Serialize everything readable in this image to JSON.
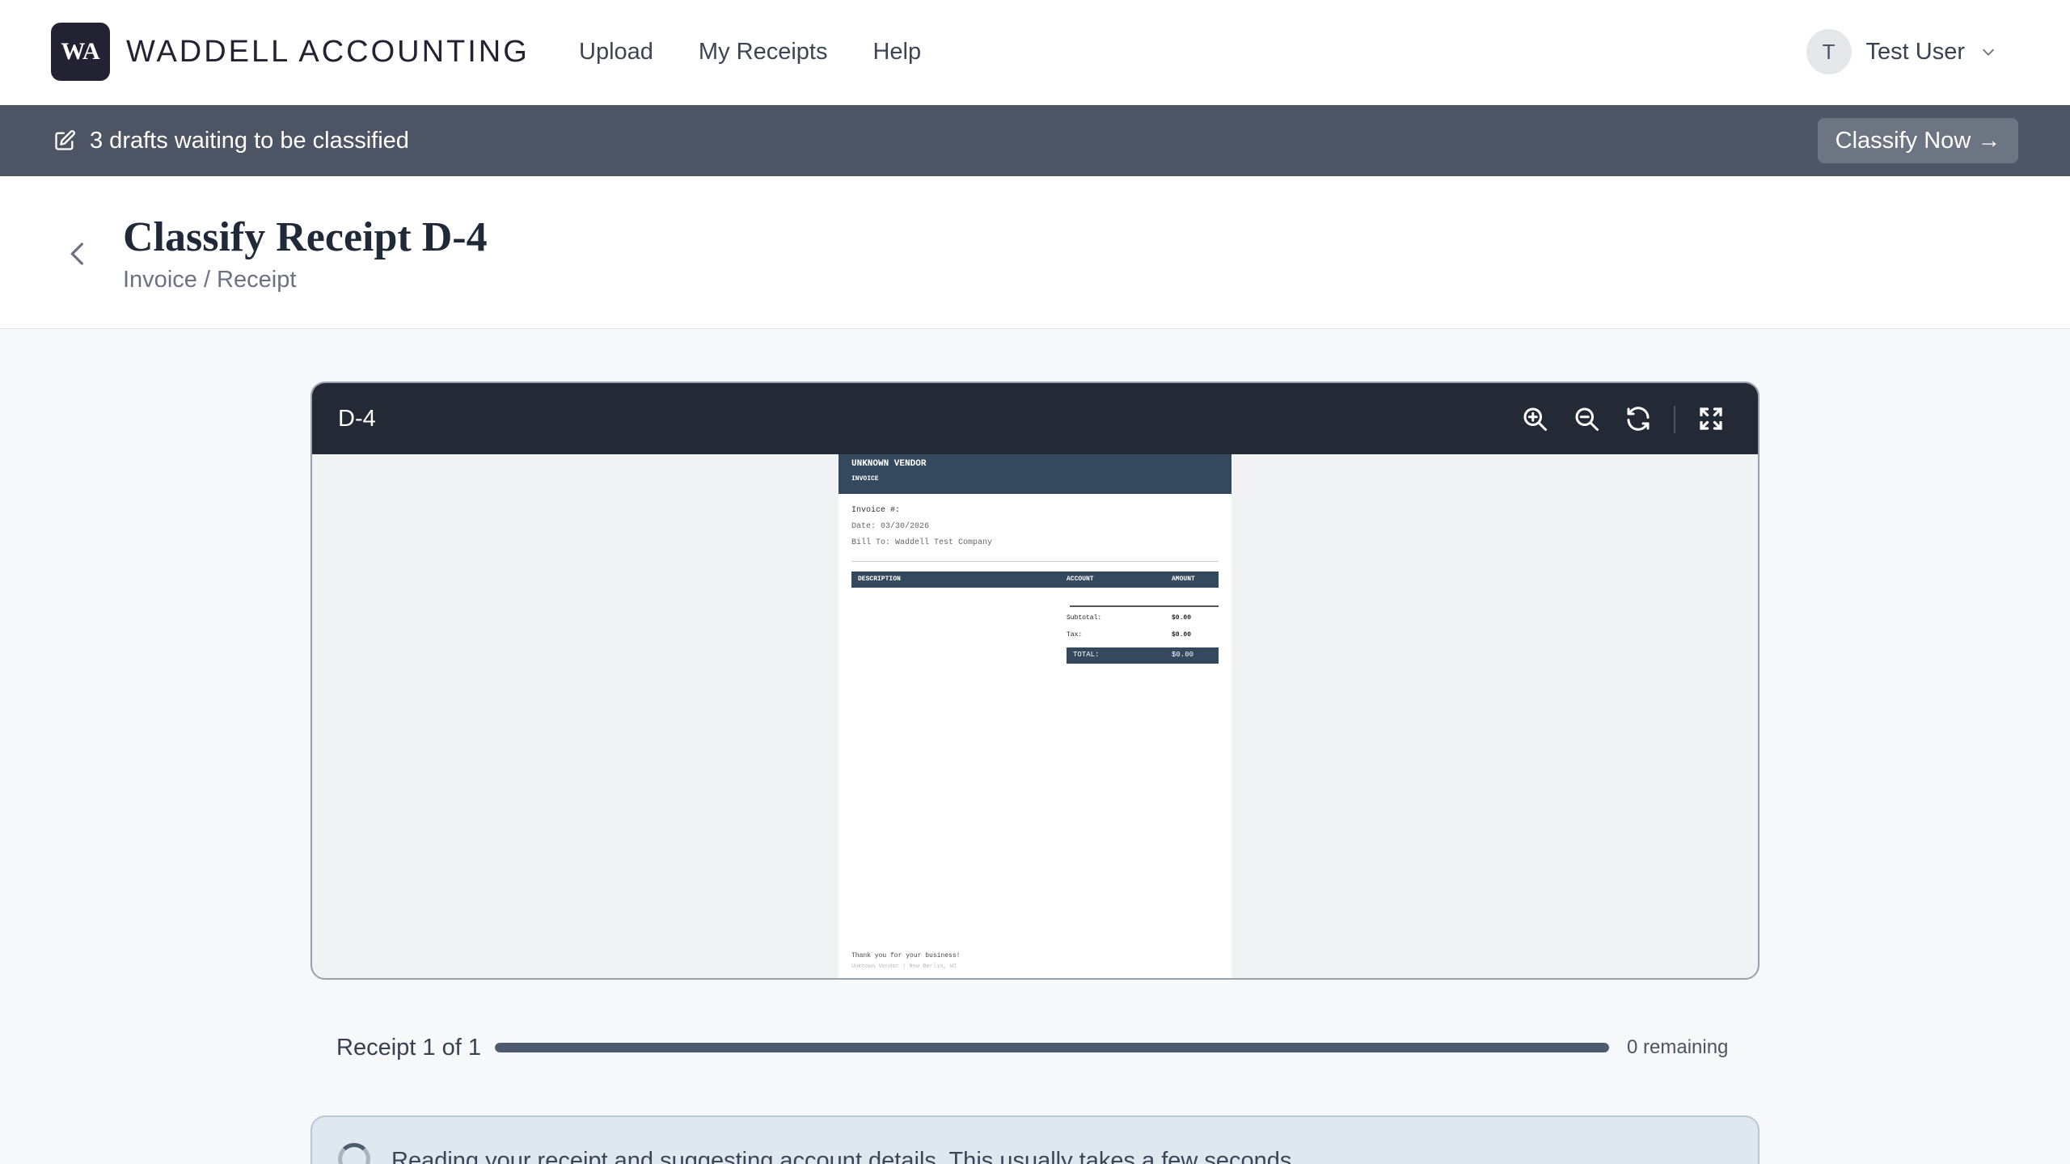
{
  "header": {
    "logo_text": "WA",
    "brand": "WADDELL ACCOUNTING",
    "nav": [
      "Upload",
      "My Receipts",
      "Help"
    ],
    "user": {
      "initial": "T",
      "name": "Test User"
    }
  },
  "banner": {
    "icon": "edit-icon",
    "text": "3 drafts waiting to be classified",
    "button_label": "Classify Now →"
  },
  "page": {
    "title": "Classify Receipt D-4",
    "breadcrumb": "Invoice / Receipt"
  },
  "viewer": {
    "title": "D-4",
    "tools": [
      "zoom-in-icon",
      "zoom-out-icon",
      "rotate-icon",
      "fullscreen-icon"
    ],
    "document": {
      "vendor": "UNKNOWN VENDOR",
      "type": "INVOICE",
      "invoice_no": "Invoice #:",
      "date": "Date: 03/30/2026",
      "bill_to": "Bill To: Waddell Test Company",
      "columns": [
        "DESCRIPTION",
        "ACCOUNT",
        "AMOUNT"
      ],
      "subtotal_label": "Subtotal:",
      "subtotal_value": "$0.00",
      "tax_label": "Tax:",
      "tax_value": "$0.00",
      "total_label": "TOTAL:",
      "total_value": "$0.00",
      "footer": "Thank you for your business!",
      "footer_sub": "Unknown Vendor | New Berlin, WI"
    }
  },
  "progress": {
    "label": "Receipt 1 of 1",
    "fraction": 1.0,
    "remaining": "0 remaining"
  },
  "status": {
    "text": "Reading your receipt and suggesting account details. This usually takes a few seconds."
  },
  "colors": {
    "brand_dark": "#232233",
    "banner_bg": "#4d5463",
    "viewer_bar": "#232935",
    "doc_header": "#34495e",
    "progress_fill": "#4d5b70"
  }
}
